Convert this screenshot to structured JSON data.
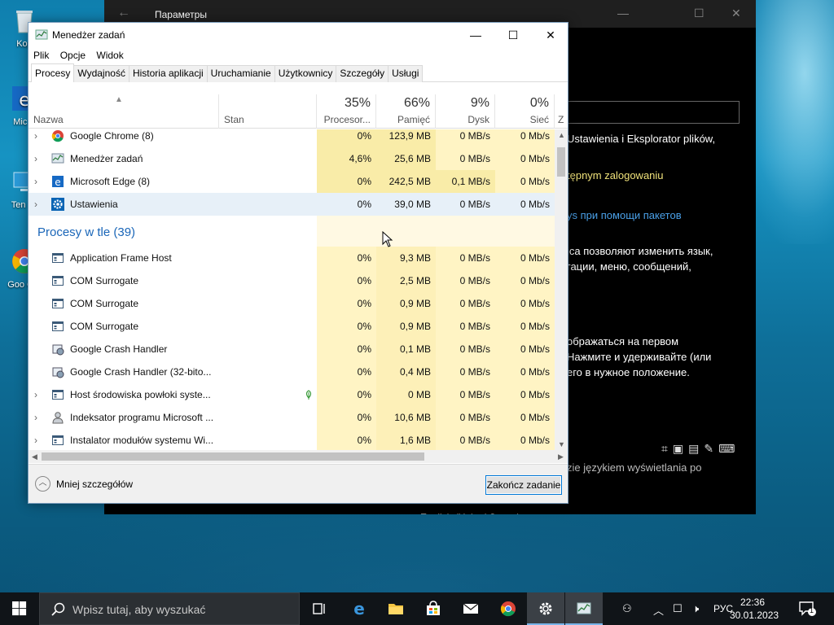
{
  "desktop": {
    "icons": [
      {
        "label": "Kop",
        "name": "recycle-bin"
      },
      {
        "label": "Mic E",
        "name": "edge-shortcut"
      },
      {
        "label": "Ten ko",
        "name": "this-pc"
      },
      {
        "label": "Goo Chr",
        "name": "chrome-shortcut"
      }
    ]
  },
  "settings_window": {
    "title": "Параметры",
    "lines": [
      {
        "text": "Ustawienia i Eksplorator plików,",
        "color": "white"
      },
      {
        "text": "tępnym zalogowaniu",
        "color": "yellow"
      },
      {
        "text": "ys при помощи пакетов",
        "color": "blue"
      },
      {
        "text": "ica позволяют изменить язык,",
        "color": "white"
      },
      {
        "text": "гации, меню, сообщений,",
        "color": "white"
      },
      {
        "text": "ображаться на первом",
        "color": "white"
      },
      {
        "text": "Нажмите и удерживайте (или",
        "color": "white"
      },
      {
        "text": "его в нужное положение.",
        "color": "white"
      },
      {
        "text": "zie językiem wyświetlania po",
        "color": "gray"
      },
      {
        "text": "English (United States)",
        "color": "white"
      }
    ]
  },
  "task_manager": {
    "title": "Menedżer zadań",
    "menu": [
      "Plik",
      "Opcje",
      "Widok"
    ],
    "tabs": [
      "Procesy",
      "Wydajność",
      "Historia aplikacji",
      "Uruchamianie",
      "Użytkownicy",
      "Szczegóły",
      "Usługi"
    ],
    "active_tab": "Procesy",
    "columns": {
      "name": "Nazwa",
      "status": "Stan",
      "cpu": {
        "label": "Procesor...",
        "pct": "35%"
      },
      "memory": {
        "label": "Pamięć",
        "pct": "66%"
      },
      "disk": {
        "label": "Dysk",
        "pct": "9%"
      },
      "network": {
        "label": "Sieć",
        "pct": "0%"
      },
      "extra": "Z"
    },
    "apps": [
      {
        "name": "Google Chrome (8)",
        "icon": "chrome-icon",
        "expandable": true,
        "cpu": "0%",
        "mem": "123,9 MB",
        "disk": "0 MB/s",
        "net": "0 Mb/s"
      },
      {
        "name": "Menedżer zadań",
        "icon": "task-manager-icon",
        "expandable": true,
        "cpu": "4,6%",
        "mem": "25,6 MB",
        "disk": "0 MB/s",
        "net": "0 Mb/s"
      },
      {
        "name": "Microsoft Edge (8)",
        "icon": "edge-icon",
        "expandable": true,
        "cpu": "0%",
        "mem": "242,5 MB",
        "disk": "0,1 MB/s",
        "net": "0 Mb/s"
      },
      {
        "name": "Ustawienia",
        "icon": "settings-gear-icon",
        "expandable": true,
        "cpu": "0%",
        "mem": "39,0 MB",
        "disk": "0 MB/s",
        "net": "0 Mb/s",
        "selected": true
      }
    ],
    "background_group": "Procesy w tle (39)",
    "background": [
      {
        "name": "Application Frame Host",
        "icon": "window-icon",
        "expandable": false,
        "cpu": "0%",
        "mem": "9,3 MB",
        "disk": "0 MB/s",
        "net": "0 Mb/s"
      },
      {
        "name": "COM Surrogate",
        "icon": "window-icon",
        "expandable": false,
        "cpu": "0%",
        "mem": "2,5 MB",
        "disk": "0 MB/s",
        "net": "0 Mb/s"
      },
      {
        "name": "COM Surrogate",
        "icon": "window-icon",
        "expandable": false,
        "cpu": "0%",
        "mem": "0,9 MB",
        "disk": "0 MB/s",
        "net": "0 Mb/s"
      },
      {
        "name": "COM Surrogate",
        "icon": "window-icon",
        "expandable": false,
        "cpu": "0%",
        "mem": "0,9 MB",
        "disk": "0 MB/s",
        "net": "0 Mb/s"
      },
      {
        "name": "Google Crash Handler",
        "icon": "crash-handler-icon",
        "expandable": false,
        "cpu": "0%",
        "mem": "0,1 MB",
        "disk": "0 MB/s",
        "net": "0 Mb/s"
      },
      {
        "name": "Google Crash Handler (32-bito...",
        "icon": "crash-handler-icon",
        "expandable": false,
        "cpu": "0%",
        "mem": "0,4 MB",
        "disk": "0 MB/s",
        "net": "0 Mb/s"
      },
      {
        "name": "Host środowiska powłoki syste...",
        "icon": "window-icon",
        "expandable": true,
        "cpu": "0%",
        "mem": "0 MB",
        "disk": "0 MB/s",
        "net": "0 Mb/s",
        "leaf": true
      },
      {
        "name": "Indeksator programu Microsoft ...",
        "icon": "indexer-icon",
        "expandable": true,
        "cpu": "0%",
        "mem": "10,6 MB",
        "disk": "0 MB/s",
        "net": "0 Mb/s"
      },
      {
        "name": "Instalator modułów systemu Wi...",
        "icon": "window-icon",
        "expandable": true,
        "cpu": "0%",
        "mem": "1,6 MB",
        "disk": "0 MB/s",
        "net": "0 Mb/s"
      }
    ],
    "fewer_details": "Mniej szczegółów",
    "end_task": "Zakończ zadanie"
  },
  "taskbar": {
    "search_placeholder": "Wpisz tutaj, aby wyszukać",
    "language": "РУС",
    "time": "22:36",
    "date": "30.01.2023",
    "notification_count": "1"
  }
}
